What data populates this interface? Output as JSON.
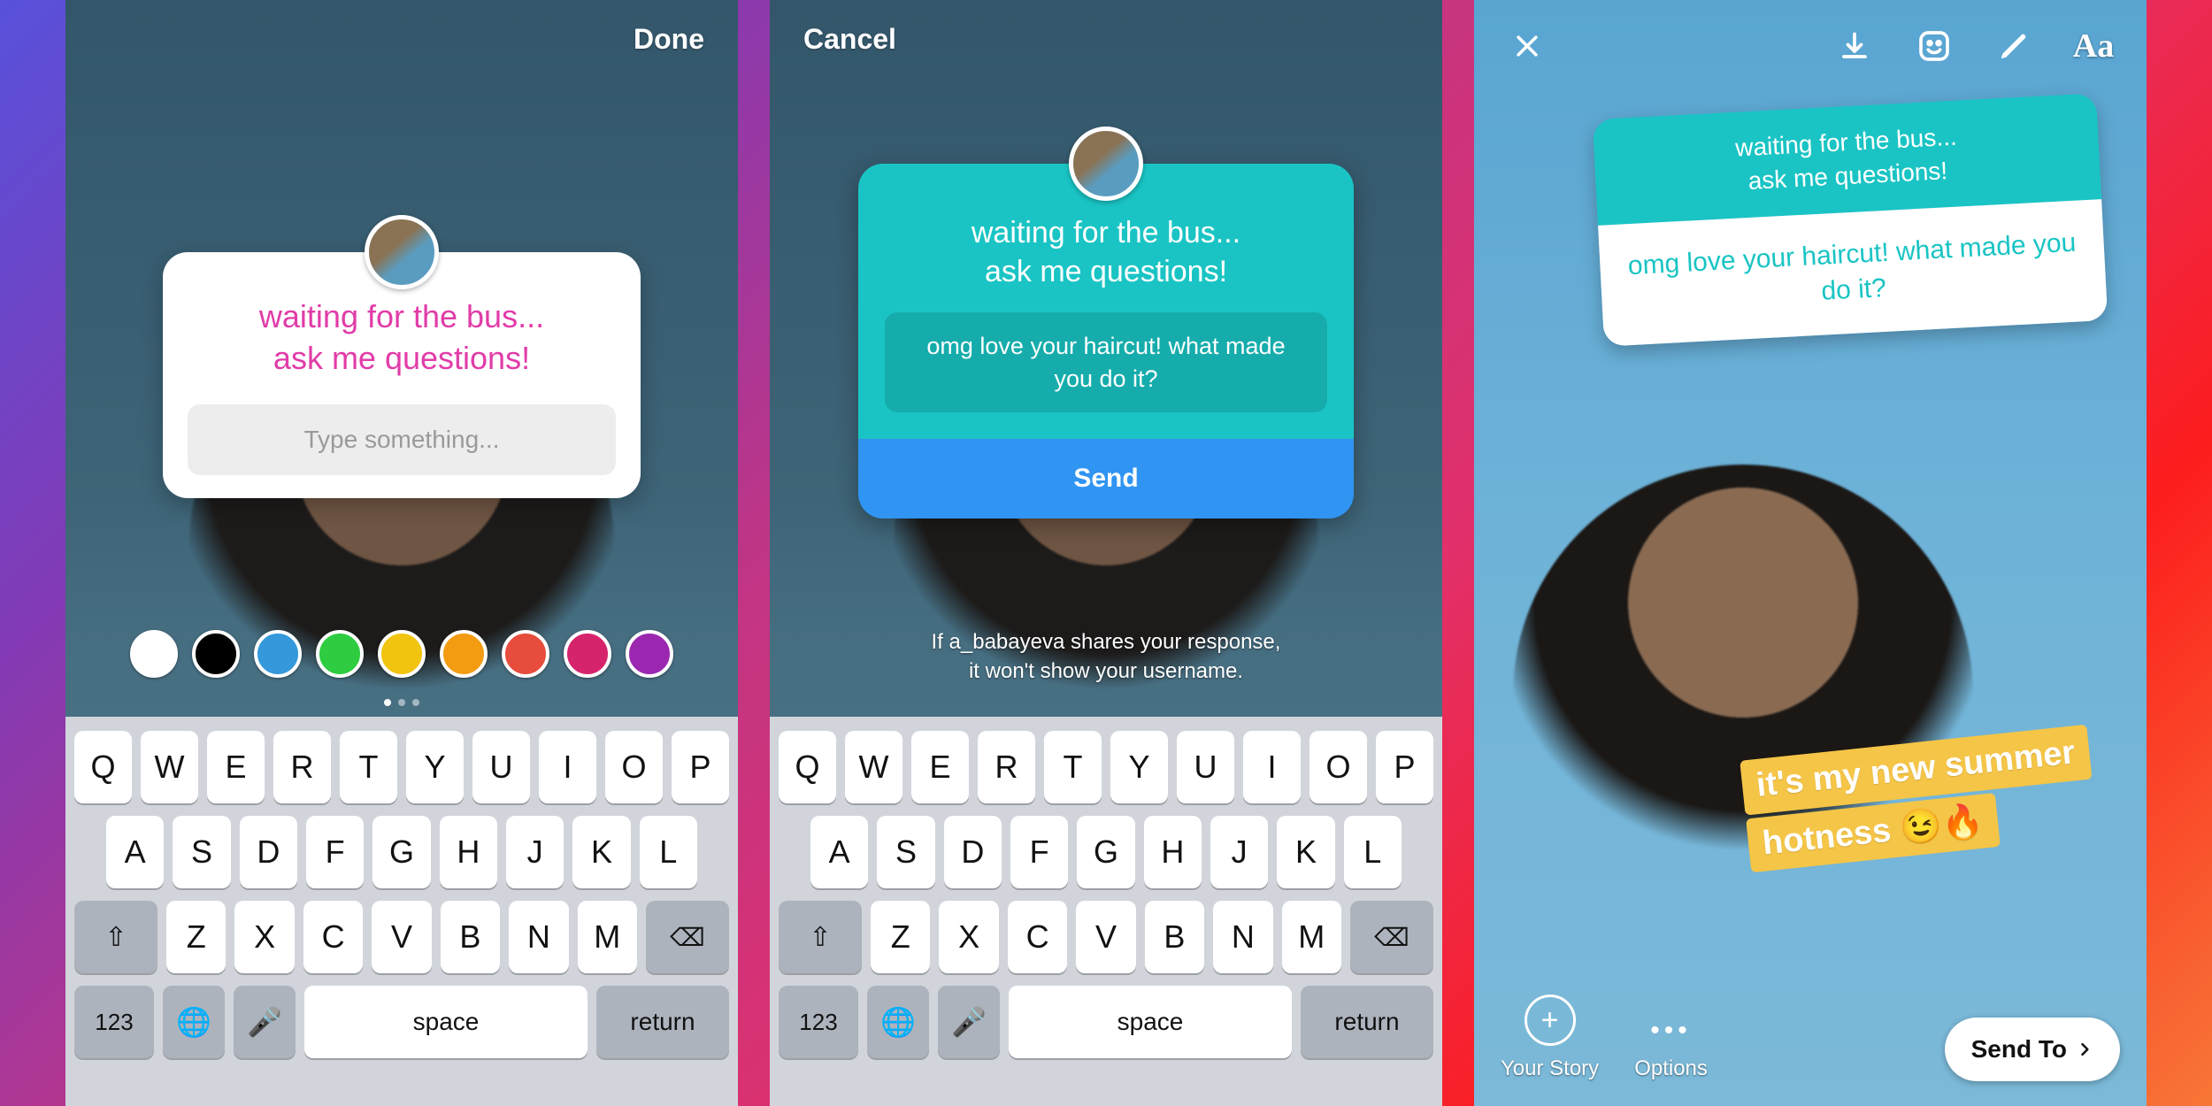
{
  "screen1": {
    "done_label": "Done",
    "prompt": "waiting for the bus...\nask me questions!",
    "placeholder": "Type something...",
    "swatches": [
      "#ffffff",
      "#000000",
      "#3498db",
      "#2ecc40",
      "#f1c40f",
      "#f39c12",
      "#e74c3c",
      "#d6246c",
      "#9b27b0"
    ]
  },
  "screen2": {
    "cancel_label": "Cancel",
    "prompt": "waiting for the bus...\nask me questions!",
    "answer_text": "omg love your haircut! what made you do it?",
    "send_label": "Send",
    "disclaimer": "If a_babayeva shares your response,\nit won't show your username."
  },
  "screen3": {
    "prompt": "waiting for the bus...\nask me questions!",
    "response": "omg love your haircut! what made you do it?",
    "reply_line1": "it's my new summer",
    "reply_line2": "hotness 😉🔥",
    "your_story_label": "Your Story",
    "options_label": "Options",
    "sendto_label": "Send To"
  },
  "keyboard": {
    "row1": [
      "Q",
      "W",
      "E",
      "R",
      "T",
      "Y",
      "U",
      "I",
      "O",
      "P"
    ],
    "row2": [
      "A",
      "S",
      "D",
      "F",
      "G",
      "H",
      "J",
      "K",
      "L"
    ],
    "row3": [
      "Z",
      "X",
      "C",
      "V",
      "B",
      "N",
      "M"
    ],
    "num_label": "123",
    "space_label": "space",
    "return_label": "return"
  }
}
